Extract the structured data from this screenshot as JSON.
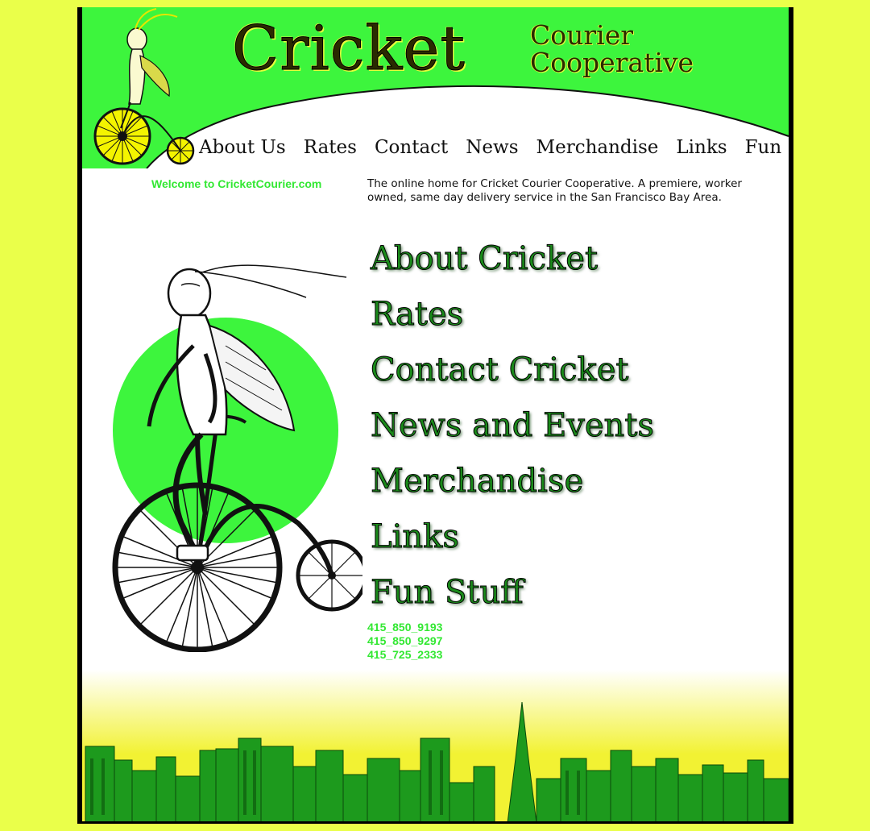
{
  "header": {
    "logo_title": "Cricket",
    "logo_line1": "Courier",
    "logo_line2": "Cooperative"
  },
  "topnav": {
    "items": [
      "About Us",
      "Rates",
      "Contact",
      "News",
      "Merchandise",
      "Links",
      "Fun Stuff"
    ]
  },
  "welcome_text": "Welcome to CricketCourier.com",
  "intro_text": "The online home for Cricket Courier Cooperative. A premiere, worker owned, same day delivery service in the San Francisco Bay Area.",
  "main_nav": {
    "items": [
      "About Cricket",
      "Rates",
      "Contact Cricket",
      "News and Events",
      "Merchandise",
      "Links",
      "Fun Stuff"
    ]
  },
  "phones": [
    "415_850_9193",
    "415_850_9297",
    "415_725_2333"
  ],
  "colors": {
    "page_bg": "#eaff4a",
    "header_green": "#3df53d",
    "accent_green": "#33e833",
    "skyline_yellow": "#f2f233",
    "skyline_green": "#1d9a1d"
  },
  "icons": {
    "logo_illustration": "cricket-on-penny-farthing-icon",
    "main_illustration": "cricket-on-penny-farthing-icon",
    "footer_illustration": "city-skyline-icon"
  }
}
